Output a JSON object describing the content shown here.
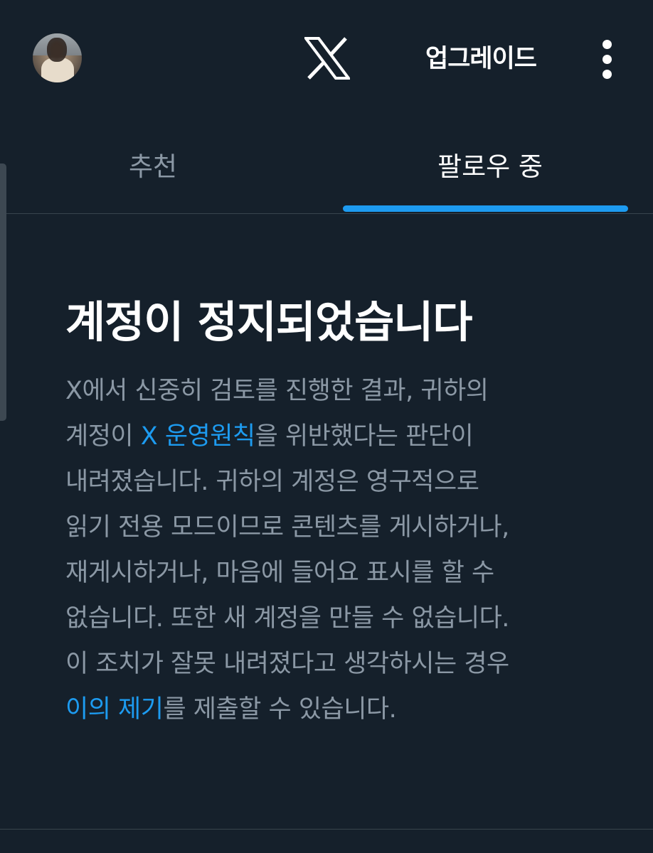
{
  "header": {
    "logo_icon": "x-logo-icon",
    "upgrade_label": "업그레이드",
    "more_icon": "more-vertical-icon"
  },
  "tabs": [
    {
      "label": "추천",
      "selected": false
    },
    {
      "label": "팔로우 중",
      "selected": true
    }
  ],
  "notice": {
    "title": "계정이 정지되었습니다",
    "line1": "X에서 신중히 검토를 진행한 결과, 귀하의",
    "line2_before": "계정이 ",
    "line2_link": "X 운영원칙",
    "line2_after": "을 위반했다는 판단이",
    "line3": "내려졌습니다. 귀하의 계정은 영구적으로",
    "line4": "읽기 전용 모드이므로 콘텐츠를 게시하거나,",
    "line5": "재게시하거나, 마음에 들어요 표시를 할 수",
    "line6": "없습니다. 또한 새 계정을 만들 수 없습니다.",
    "line7": "이 조치가 잘못 내려졌다고 생각하시는 경우",
    "line8_link": "이의 제기",
    "line8_after": "를 제출할 수 있습니다."
  },
  "colors": {
    "background": "#15202b",
    "accent": "#1d9bf0",
    "text_primary": "#ffffff",
    "text_secondary": "#8b98a5",
    "divider": "#38444d"
  }
}
